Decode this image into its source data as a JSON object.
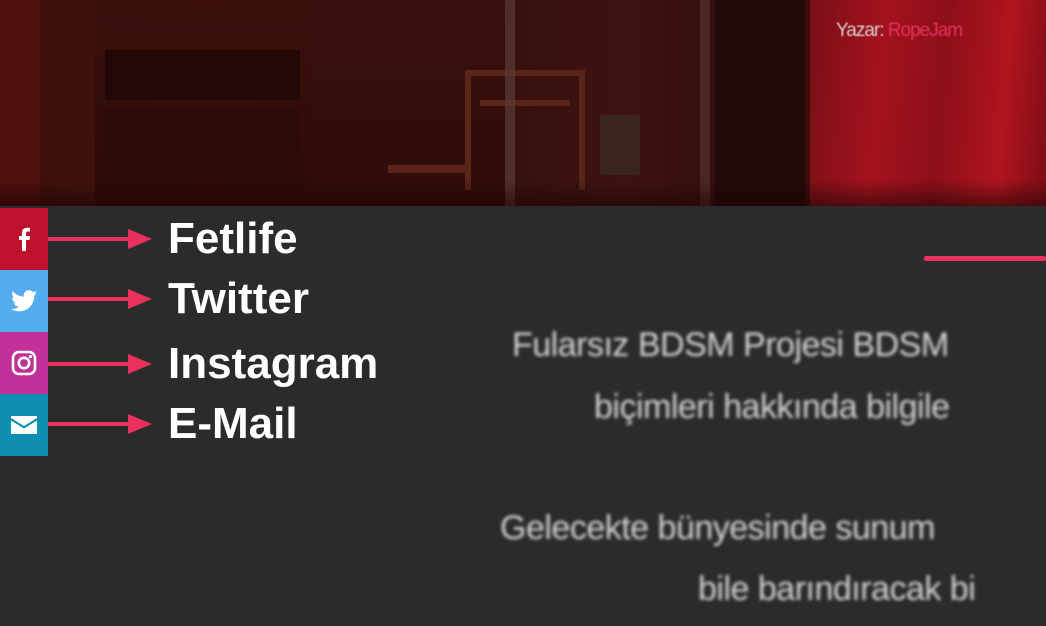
{
  "hero": {
    "author_label": "Yazar:",
    "author_name": "RopeJam"
  },
  "social": [
    {
      "label": "Fetlife",
      "icon": "facebook-icon",
      "color": "#c0112e"
    },
    {
      "label": "Twitter",
      "icon": "twitter-icon",
      "color": "#54acec"
    },
    {
      "label": "Instagram",
      "icon": "instagram-icon",
      "color": "#c2309a"
    },
    {
      "label": "E-Mail",
      "icon": "mail-icon",
      "color": "#0f8fb0"
    }
  ],
  "annotation_color": "#e8315c",
  "content": {
    "line1": "Fularsız BDSM Projesi BDSM",
    "line2": "biçimleri hakkında bilgile",
    "line3": "Gelecekte bünyesinde sunum",
    "line4": "bile barındıracak bi"
  }
}
